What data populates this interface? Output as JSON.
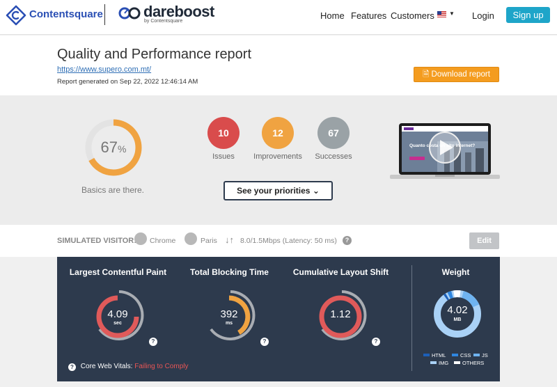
{
  "header": {
    "cs_name": "Contentsquare",
    "db_name": "dareboost",
    "db_sub": "by Contentsquare",
    "nav": [
      "Home",
      "Features",
      "Customers"
    ],
    "login": "Login",
    "signup": "Sign up"
  },
  "report": {
    "title": "Quality and Performance report",
    "url": "https://www.supero.com.mt/",
    "generated": "Report generated on Sep 22, 2022 12:46:14 AM",
    "download_label": "Download report"
  },
  "summary": {
    "score": "67",
    "score_unit": "%",
    "score_fraction": 0.67,
    "score_caption": "Basics are there.",
    "issues": {
      "count": "10",
      "label": "Issues",
      "color": "#d94c4c"
    },
    "improvements": {
      "count": "12",
      "label": "Improvements",
      "color": "#f0a341"
    },
    "successes": {
      "count": "67",
      "label": "Successes",
      "color": "#9aa2a6"
    },
    "priorities_label": "See your priorities",
    "screenshot_text": "Quanto costa un sito internet?"
  },
  "visitor": {
    "label": "SIMULATED VISITOR:",
    "browser": "Chrome",
    "location": "Paris",
    "connection": "8.0/1.5Mbps (Latency: 50 ms)",
    "edit_label": "Edit"
  },
  "metrics": {
    "lcp": {
      "title": "Largest Contentful Paint",
      "value": "4.09",
      "unit": "sec",
      "color": "#e05a5a"
    },
    "tbt": {
      "title": "Total Blocking Time",
      "value": "392",
      "unit": "ms",
      "color": "#f0a341"
    },
    "cls": {
      "title": "Cumulative Layout Shift",
      "value": "1.12",
      "unit": "",
      "color": "#e05a5a"
    },
    "weight": {
      "title": "Weight",
      "value": "4.02",
      "unit": "MB",
      "legend": [
        {
          "label": "HTML",
          "color": "#1d5fb8"
        },
        {
          "label": "CSS",
          "color": "#2f86e0"
        },
        {
          "label": "JS",
          "color": "#6fb3f0"
        },
        {
          "label": "IMG",
          "color": "#a9d1f6"
        },
        {
          "label": "OTHERS",
          "color": "#ffffff"
        }
      ]
    },
    "cwv_label": "Core Web Vitals:",
    "cwv_status": "Failing to Comply"
  }
}
